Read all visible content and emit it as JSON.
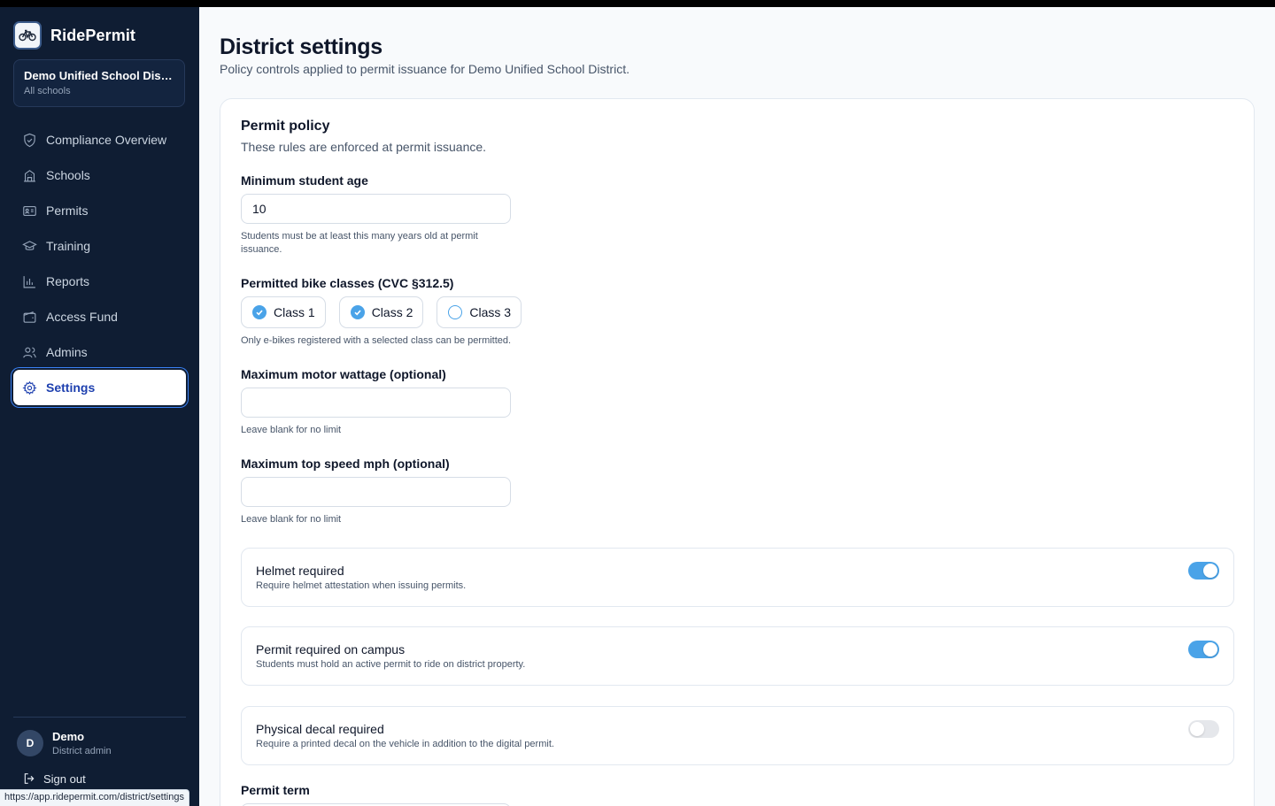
{
  "app": {
    "name": "RidePermit"
  },
  "district": {
    "name": "Demo Unified School District",
    "scope": "All schools"
  },
  "nav": [
    {
      "label": "Compliance Overview",
      "icon": "shield-icon"
    },
    {
      "label": "Schools",
      "icon": "building-icon"
    },
    {
      "label": "Permits",
      "icon": "id-card-icon"
    },
    {
      "label": "Training",
      "icon": "graduation-cap-icon"
    },
    {
      "label": "Reports",
      "icon": "bar-chart-icon"
    },
    {
      "label": "Access Fund",
      "icon": "wallet-icon"
    },
    {
      "label": "Admins",
      "icon": "users-icon"
    },
    {
      "label": "Settings",
      "icon": "gear-icon",
      "active": true
    }
  ],
  "user": {
    "initial": "D",
    "name": "Demo",
    "role": "District admin"
  },
  "signout_label": "Sign out",
  "status_url": "https://app.ridepermit.com/district/settings",
  "page": {
    "title": "District settings",
    "subtitle": "Policy controls applied to permit issuance for Demo Unified School District."
  },
  "policy": {
    "title": "Permit policy",
    "subtitle": "These rules are enforced at permit issuance.",
    "min_age": {
      "label": "Minimum student age",
      "value": "10",
      "help": "Students must be at least this many years old at permit issuance."
    },
    "bike_classes": {
      "label": "Permitted bike classes (CVC §312.5)",
      "options": [
        {
          "label": "Class 1",
          "checked": true
        },
        {
          "label": "Class 2",
          "checked": true
        },
        {
          "label": "Class 3",
          "checked": false
        }
      ],
      "help": "Only e-bikes registered with a selected class can be permitted."
    },
    "max_wattage": {
      "label": "Maximum motor wattage (optional)",
      "value": "",
      "help": "Leave blank for no limit"
    },
    "max_speed": {
      "label": "Maximum top speed mph (optional)",
      "value": "",
      "help": "Leave blank for no limit"
    },
    "toggles": [
      {
        "title": "Helmet required",
        "desc": "Require helmet attestation when issuing permits.",
        "on": true
      },
      {
        "title": "Permit required on campus",
        "desc": "Students must hold an active permit to ride on district property.",
        "on": true
      },
      {
        "title": "Physical decal required",
        "desc": "Require a printed decal on the vehicle in addition to the digital permit.",
        "on": false
      }
    ],
    "permit_term": {
      "label": "Permit term"
    }
  },
  "colors": {
    "sidebar": "#0f1d33",
    "accent": "#4aa3e8",
    "active_text": "#1e40af"
  }
}
